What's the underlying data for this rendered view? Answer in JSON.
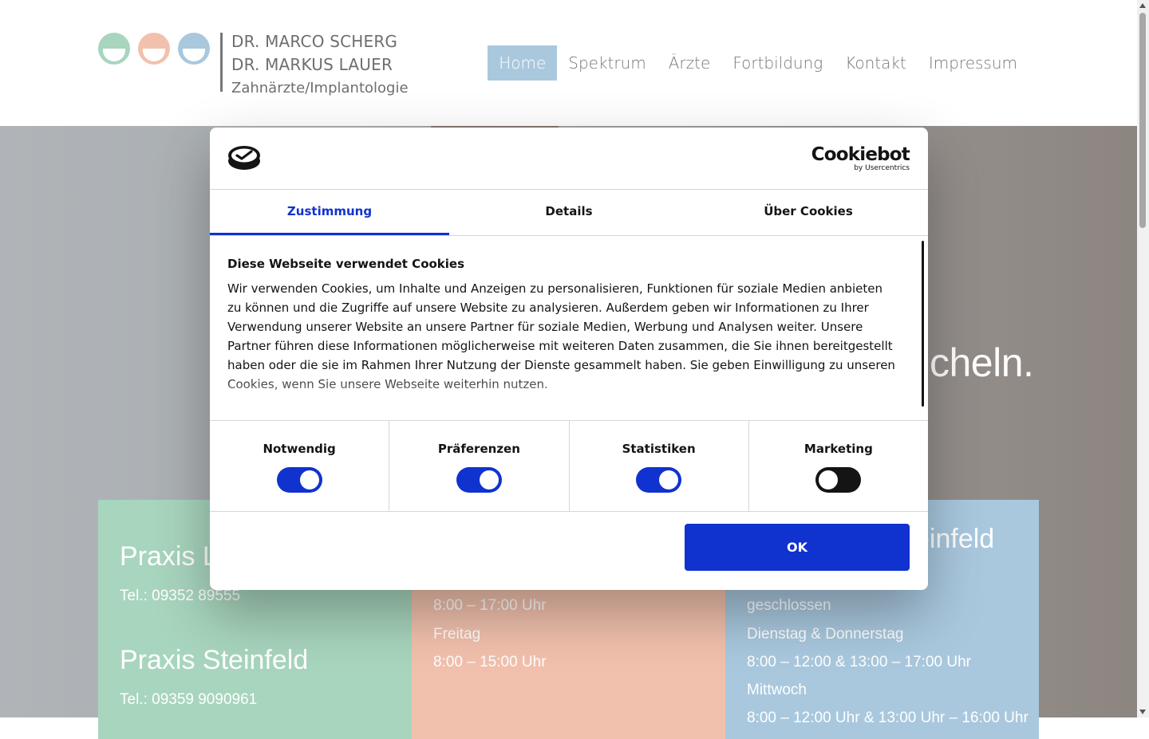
{
  "header": {
    "logo": {
      "line1": "DR. MARCO SCHERG",
      "line2": "DR. MARKUS LAUER",
      "line3": "Zahnärzte/Implantologie",
      "circle_colors": [
        "#a8d5bd",
        "#f2c1ad",
        "#a9c8de"
      ]
    },
    "nav": [
      {
        "label": "Home",
        "active": true
      },
      {
        "label": "Spektrum"
      },
      {
        "label": "Ärzte"
      },
      {
        "label": "Fortbildung"
      },
      {
        "label": "Kontakt"
      },
      {
        "label": "Impressum"
      }
    ],
    "active_color": "#a9c8de"
  },
  "hero": {
    "tagline_fragment": "cheln."
  },
  "boxes": {
    "b1": {
      "title1": "Praxis L",
      "tel1": "Tel.: 09352 89555",
      "title2": "Praxis Steinfeld",
      "tel2": "Tel.: 09359 9090961"
    },
    "b2": {
      "l1": "8:00 – 17:00 Uhr",
      "l2": "Freitag",
      "l3": "8:00 – 15:00 Uhr"
    },
    "b3": {
      "title": "einfeld",
      "l1": "geschlossen",
      "l2": "Dienstag & Donnerstag",
      "l3": "8:00 – 12:00 & 13:00 – 17:00 Uhr",
      "l4": "Mittwoch",
      "l5": "8:00 – 12:00 Uhr & 13:00 Uhr – 16:00 Uhr"
    }
  },
  "cookie": {
    "brand": "Cookiebot",
    "brand_sub": "by Usercentrics",
    "tabs": [
      "Zustimmung",
      "Details",
      "Über Cookies"
    ],
    "title": "Diese Webseite verwendet Cookies",
    "body": "Wir verwenden Cookies, um Inhalte und Anzeigen zu personalisieren, Funktionen für soziale Medien anbieten zu können und die Zugriffe auf unsere Website zu analysieren. Außerdem geben wir Informationen zu Ihrer Verwendung unserer Website an unsere Partner für soziale Medien, Werbung und Analysen weiter. Unsere Partner führen diese Informationen möglicherweise mit weiteren Daten zusammen, die Sie ihnen bereitgestellt haben oder die sie im Rahmen Ihrer Nutzung der Dienste gesammelt haben. Sie geben Einwilligung zu unseren Cookies, wenn Sie unsere Webseite weiterhin nutzen.",
    "toggles": [
      {
        "label": "Notwendig",
        "on": true
      },
      {
        "label": "Präferenzen",
        "on": true
      },
      {
        "label": "Statistiken",
        "on": true
      },
      {
        "label": "Marketing",
        "on": false
      }
    ],
    "ok_label": "OK",
    "accent": "#1032cf"
  }
}
